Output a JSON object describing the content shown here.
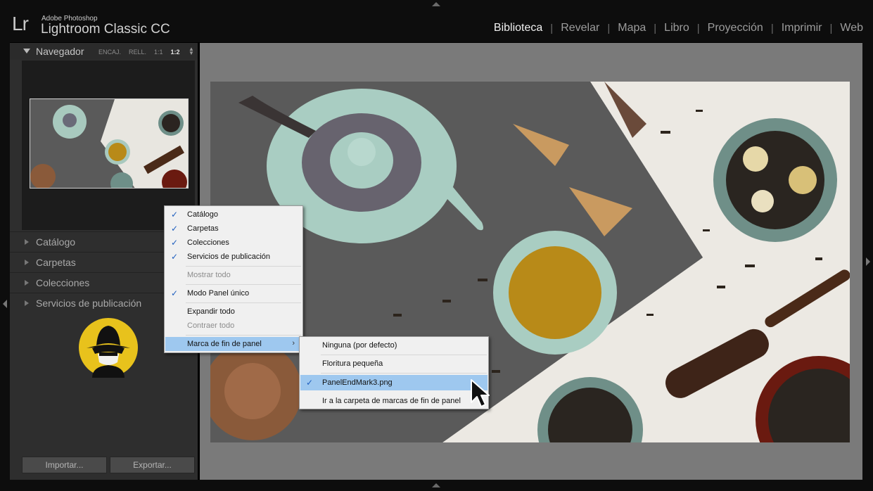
{
  "app": {
    "logo": "Lr",
    "vendor": "Adobe Photoshop",
    "product": "Lightroom Classic CC"
  },
  "modules": [
    {
      "label": "Biblioteca",
      "active": true
    },
    {
      "label": "Revelar",
      "active": false
    },
    {
      "label": "Mapa",
      "active": false
    },
    {
      "label": "Libro",
      "active": false
    },
    {
      "label": "Proyección",
      "active": false
    },
    {
      "label": "Imprimir",
      "active": false
    },
    {
      "label": "Web",
      "active": false
    }
  ],
  "navigator": {
    "title": "Navegador",
    "zoom_options": [
      "ENCAJ.",
      "RELL.",
      "1:1",
      "1:2"
    ],
    "selected_zoom": "1:2"
  },
  "panels": [
    {
      "label": "Catálogo"
    },
    {
      "label": "Carpetas"
    },
    {
      "label": "Colecciones"
    },
    {
      "label": "Servicios de publicación"
    }
  ],
  "buttons": {
    "import": "Importar...",
    "export": "Exportar..."
  },
  "context_menu": {
    "items": [
      {
        "label": "Catálogo",
        "checked": true,
        "disabled": false
      },
      {
        "label": "Carpetas",
        "checked": true,
        "disabled": false
      },
      {
        "label": "Colecciones",
        "checked": true,
        "disabled": false
      },
      {
        "label": "Servicios de publicación",
        "checked": true,
        "disabled": false
      },
      {
        "label": "Mostrar todo",
        "checked": false,
        "disabled": true
      },
      {
        "label": "Modo Panel único",
        "checked": true,
        "disabled": false
      },
      {
        "label": "Expandir todo",
        "checked": false,
        "disabled": false
      },
      {
        "label": "Contraer todo",
        "checked": false,
        "disabled": true
      },
      {
        "label": "Marca de fin de panel",
        "checked": false,
        "disabled": false,
        "highlighted": true,
        "submenu": true
      }
    ],
    "submenu_arrow": "›",
    "check_mark": "✓"
  },
  "submenu": {
    "items": [
      {
        "label": "Ninguna (por defecto)",
        "checked": false
      },
      {
        "label": "Floritura pequeña",
        "checked": false
      },
      {
        "label": "PanelEndMark3.png",
        "checked": true,
        "highlighted": true
      },
      {
        "label": "Ir a la carpeta de marcas de fin de panel",
        "checked": false
      }
    ]
  },
  "icons": {
    "panel_end_mark": "spy-character-icon",
    "cursor": "mouse-pointer-icon"
  },
  "colors": {
    "menu_highlight": "#9ec8ef",
    "check": "#1f5fbf",
    "panel_bg": "#2e2e2e",
    "center_bg": "#7a7a7a"
  }
}
